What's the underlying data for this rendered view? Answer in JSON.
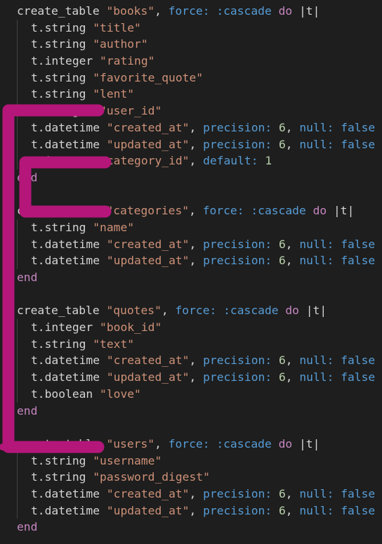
{
  "editor": {
    "lines": [
      {
        "kind": "header",
        "fn": "create_table",
        "name": "\"books\"",
        "opt": "force:",
        "optval": ":cascade",
        "kw": "do",
        "block": "|t|"
      },
      {
        "kind": "col",
        "type": "t.string",
        "name": "\"title\""
      },
      {
        "kind": "col",
        "type": "t.string",
        "name": "\"author\""
      },
      {
        "kind": "col",
        "type": "t.integer",
        "name": "\"rating\""
      },
      {
        "kind": "col",
        "type": "t.string",
        "name": "\"favorite_quote\""
      },
      {
        "kind": "col",
        "type": "t.string",
        "name": "\"lent\""
      },
      {
        "kind": "col",
        "type": "t.integer",
        "name": "\"user_id\""
      },
      {
        "kind": "colopts",
        "type": "t.datetime",
        "name": "\"created_at\"",
        "o1": "precision:",
        "v1": "6",
        "o2": "null:",
        "v2": "false"
      },
      {
        "kind": "colopts",
        "type": "t.datetime",
        "name": "\"updated_at\"",
        "o1": "precision:",
        "v1": "6",
        "o2": "null:",
        "v2": "false"
      },
      {
        "kind": "coldef",
        "type": "t.integer",
        "name": "\"category_id\"",
        "o1": "default:",
        "v1": "1"
      },
      {
        "kind": "end",
        "text": "end"
      },
      {
        "kind": "blank"
      },
      {
        "kind": "header",
        "fn": "create_table",
        "name": "\"categories\"",
        "opt": "force:",
        "optval": ":cascade",
        "kw": "do",
        "block": "|t|"
      },
      {
        "kind": "col",
        "type": "t.string",
        "name": "\"name\""
      },
      {
        "kind": "colopts",
        "type": "t.datetime",
        "name": "\"created_at\"",
        "o1": "precision:",
        "v1": "6",
        "o2": "null:",
        "v2": "false"
      },
      {
        "kind": "colopts",
        "type": "t.datetime",
        "name": "\"updated_at\"",
        "o1": "precision:",
        "v1": "6",
        "o2": "null:",
        "v2": "false"
      },
      {
        "kind": "end",
        "text": "end"
      },
      {
        "kind": "blank"
      },
      {
        "kind": "header",
        "fn": "create_table",
        "name": "\"quotes\"",
        "opt": "force:",
        "optval": ":cascade",
        "kw": "do",
        "block": "|t|"
      },
      {
        "kind": "col",
        "type": "t.integer",
        "name": "\"book_id\""
      },
      {
        "kind": "col",
        "type": "t.string",
        "name": "\"text\""
      },
      {
        "kind": "colopts",
        "type": "t.datetime",
        "name": "\"created_at\"",
        "o1": "precision:",
        "v1": "6",
        "o2": "null:",
        "v2": "false"
      },
      {
        "kind": "colopts",
        "type": "t.datetime",
        "name": "\"updated_at\"",
        "o1": "precision:",
        "v1": "6",
        "o2": "null:",
        "v2": "false"
      },
      {
        "kind": "col",
        "type": "t.boolean",
        "name": "\"love\""
      },
      {
        "kind": "end",
        "text": "end"
      },
      {
        "kind": "blank"
      },
      {
        "kind": "header",
        "fn": "create_table",
        "name": "\"users\"",
        "opt": "force:",
        "optval": ":cascade",
        "kw": "do",
        "block": "|t|"
      },
      {
        "kind": "col",
        "type": "t.string",
        "name": "\"username\""
      },
      {
        "kind": "col",
        "type": "t.string",
        "name": "\"password_digest\""
      },
      {
        "kind": "colopts",
        "type": "t.datetime",
        "name": "\"created_at\"",
        "o1": "precision:",
        "v1": "6",
        "o2": "null:",
        "v2": "false"
      },
      {
        "kind": "colopts",
        "type": "t.datetime",
        "name": "\"updated_at\"",
        "o1": "precision:",
        "v1": "6",
        "o2": "null:",
        "v2": "false"
      },
      {
        "kind": "end",
        "text": "end"
      }
    ]
  },
  "annotation": {
    "description_color": "#b5167a"
  },
  "colors": {
    "background": "#1e1e1e",
    "text": "#d4d4d4",
    "string": "#ce9178",
    "symbol_and_option": "#569cd6",
    "keyword": "#c586c0",
    "number": "#b5cea8",
    "method": "#dcdcaa",
    "markup": "#b5167a"
  }
}
